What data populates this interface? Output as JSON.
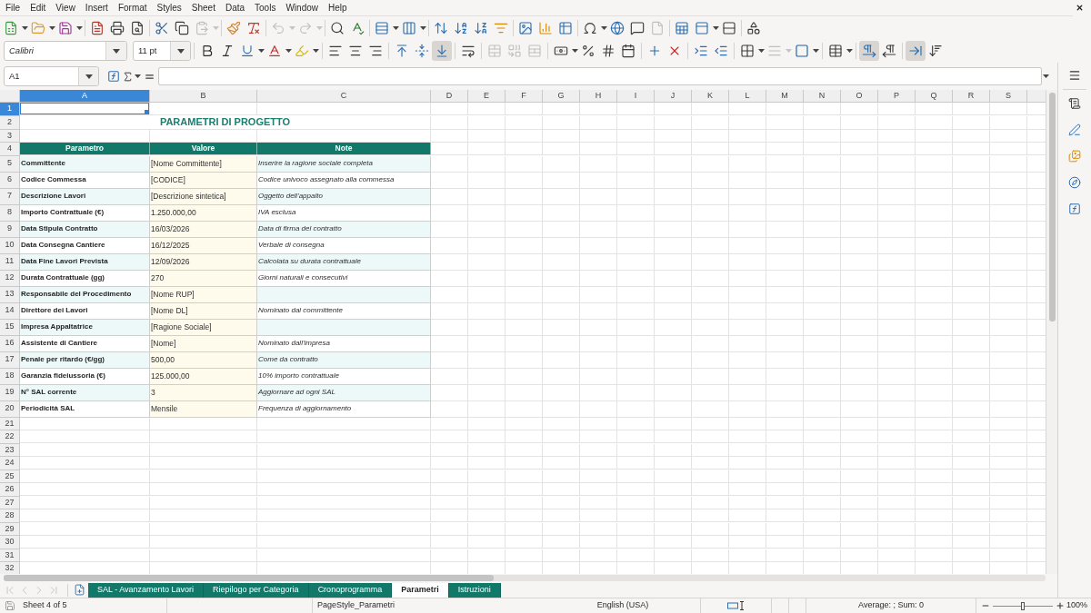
{
  "menu": [
    "File",
    "Edit",
    "View",
    "Insert",
    "Format",
    "Styles",
    "Sheet",
    "Data",
    "Tools",
    "Window",
    "Help"
  ],
  "standard_toolbar": [
    [
      {
        "kind": "new",
        "disabled": false
      },
      {
        "kind": "open",
        "disabled": false
      },
      {
        "kind": "save",
        "disabled": false
      }
    ],
    [
      {
        "kind": "pdf",
        "disabled": false
      },
      {
        "kind": "print",
        "disabled": false
      },
      {
        "kind": "preview",
        "disabled": false
      }
    ],
    [
      {
        "kind": "cut",
        "disabled": false
      },
      {
        "kind": "copy",
        "disabled": false
      },
      {
        "kind": "paste",
        "disabled": true
      }
    ],
    [
      {
        "kind": "clone",
        "disabled": false
      },
      {
        "kind": "clear",
        "disabled": false
      }
    ],
    [
      {
        "kind": "undo",
        "disabled": true
      },
      {
        "kind": "redo",
        "disabled": true
      }
    ],
    [
      {
        "kind": "find",
        "disabled": false
      },
      {
        "kind": "spelling",
        "disabled": false
      }
    ],
    [
      {
        "kind": "row",
        "disabled": false
      },
      {
        "kind": "column",
        "disabled": false
      }
    ],
    [
      {
        "kind": "sort",
        "disabled": false
      },
      {
        "kind": "ascending",
        "disabled": false
      },
      {
        "kind": "descending",
        "disabled": false
      },
      {
        "kind": "filter",
        "disabled": false
      }
    ],
    [
      {
        "kind": "image",
        "disabled": false
      },
      {
        "kind": "chart",
        "disabled": false
      },
      {
        "kind": "pivot",
        "disabled": false
      }
    ],
    [
      {
        "kind": "symbol",
        "disabled": false
      },
      {
        "kind": "hyperlink",
        "disabled": false
      },
      {
        "kind": "comment",
        "disabled": false
      },
      {
        "kind": "headers",
        "disabled": true
      }
    ],
    [
      {
        "kind": "printarea",
        "disabled": false
      },
      {
        "kind": "freeze",
        "disabled": false
      },
      {
        "kind": "split",
        "disabled": false
      }
    ],
    [
      {
        "kind": "draw",
        "disabled": false
      }
    ]
  ],
  "format_toolbar": {
    "font_name": "Calibri",
    "font_size": "11 pt",
    "groups": [
      [
        {
          "kind": "bold",
          "on": false,
          "disabled": false
        },
        {
          "kind": "italic",
          "on": false,
          "disabled": false
        },
        {
          "kind": "underline",
          "on": false,
          "disabled": false
        },
        {
          "kind": "fontcolor",
          "on": false,
          "disabled": false
        },
        {
          "kind": "highlight",
          "on": false,
          "disabled": false
        }
      ],
      [
        {
          "kind": "left",
          "on": false,
          "disabled": false
        },
        {
          "kind": "center",
          "on": false,
          "disabled": false
        },
        {
          "kind": "right",
          "on": false,
          "disabled": false
        }
      ],
      [
        {
          "kind": "top",
          "on": false,
          "disabled": false
        },
        {
          "kind": "middle",
          "on": false,
          "disabled": false
        },
        {
          "kind": "bottom",
          "on": true,
          "disabled": false
        }
      ],
      [
        {
          "kind": "wrap",
          "on": false,
          "disabled": false
        }
      ],
      [
        {
          "kind": "mergecenter",
          "on": false,
          "disabled": true
        },
        {
          "kind": "merge",
          "on": false,
          "disabled": true
        },
        {
          "kind": "unmerge",
          "on": false,
          "disabled": true
        }
      ],
      [
        {
          "kind": "currency",
          "on": false,
          "disabled": false
        },
        {
          "kind": "percent",
          "on": false,
          "disabled": false
        },
        {
          "kind": "number",
          "on": false,
          "disabled": false
        },
        {
          "kind": "date",
          "on": false,
          "disabled": false
        }
      ],
      [
        {
          "kind": "adddecimal",
          "on": false,
          "disabled": false
        },
        {
          "kind": "deldecimal",
          "on": false,
          "disabled": false
        }
      ],
      [
        {
          "kind": "indent",
          "on": false,
          "disabled": false
        },
        {
          "kind": "outdent",
          "on": false,
          "disabled": false
        }
      ],
      [
        {
          "kind": "borders",
          "on": false,
          "disabled": false
        },
        {
          "kind": "borderstyle",
          "on": false,
          "disabled": true
        },
        {
          "kind": "bordercolor",
          "on": false,
          "disabled": false
        }
      ],
      [
        {
          "kind": "conditional",
          "on": false,
          "disabled": false
        }
      ],
      [
        {
          "kind": "ltr",
          "on": true,
          "disabled": false
        },
        {
          "kind": "rtl",
          "on": false,
          "disabled": false
        }
      ],
      [
        {
          "kind": "horizontal",
          "on": true,
          "disabled": false
        },
        {
          "kind": "vertical",
          "on": false,
          "disabled": false
        }
      ]
    ]
  },
  "formula_bar": {
    "cell_reference": "A1"
  },
  "sheet": {
    "columns": [
      {
        "label": "A",
        "selected": true
      },
      {
        "label": "B",
        "selected": false
      },
      {
        "label": "C",
        "selected": false
      },
      {
        "label": "D",
        "selected": false
      },
      {
        "label": "E",
        "selected": false
      },
      {
        "label": "F",
        "selected": false
      },
      {
        "label": "G",
        "selected": false
      },
      {
        "label": "H",
        "selected": false
      },
      {
        "label": "I",
        "selected": false
      },
      {
        "label": "J",
        "selected": false
      },
      {
        "label": "K",
        "selected": false
      },
      {
        "label": "L",
        "selected": false
      },
      {
        "label": "M",
        "selected": false
      },
      {
        "label": "N",
        "selected": false
      },
      {
        "label": "O",
        "selected": false
      },
      {
        "label": "P",
        "selected": false
      },
      {
        "label": "Q",
        "selected": false
      },
      {
        "label": "R",
        "selected": false
      },
      {
        "label": "S",
        "selected": false
      }
    ],
    "rows": [
      {
        "number": "1",
        "selected": true,
        "kind": "blank"
      },
      {
        "number": "2",
        "selected": false,
        "kind": "title",
        "cells": [
          "PARAMETRI DI PROGETTO"
        ]
      },
      {
        "number": "3",
        "selected": false,
        "kind": "blank"
      },
      {
        "number": "4",
        "selected": false,
        "kind": "header",
        "cells": [
          "Parametro",
          "Valore",
          "Note"
        ]
      },
      {
        "number": "5",
        "selected": false,
        "kind": "data",
        "cells": [
          "Committente",
          "[Nome Committente]",
          "Inserire la ragione sociale completa"
        ]
      },
      {
        "number": "6",
        "selected": false,
        "kind": "data",
        "cells": [
          "Codice Commessa",
          "[CODICE]",
          "Codice univoco assegnato alla commessa"
        ]
      },
      {
        "number": "7",
        "selected": false,
        "kind": "data",
        "cells": [
          "Descrizione Lavori",
          "[Descrizione sintetica]",
          "Oggetto dell'appalto"
        ]
      },
      {
        "number": "8",
        "selected": false,
        "kind": "data",
        "cells": [
          "Importo Contrattuale (€)",
          "1.250.000,00",
          "IVA esclusa"
        ]
      },
      {
        "number": "9",
        "selected": false,
        "kind": "data",
        "cells": [
          "Data Stipula Contratto",
          "16/03/2026",
          "Data di firma del contratto"
        ]
      },
      {
        "number": "10",
        "selected": false,
        "kind": "data",
        "cells": [
          "Data Consegna Cantiere",
          "16/12/2025",
          "Verbale di consegna"
        ]
      },
      {
        "number": "11",
        "selected": false,
        "kind": "data",
        "cells": [
          "Data Fine Lavori Prevista",
          "12/09/2026",
          "Calcolata su durata contrattuale"
        ]
      },
      {
        "number": "12",
        "selected": false,
        "kind": "data",
        "cells": [
          "Durata Contrattuale (gg)",
          "270",
          "Giorni naturali e consecutivi"
        ]
      },
      {
        "number": "13",
        "selected": false,
        "kind": "data",
        "cells": [
          "Responsabile del Procedimento",
          "[Nome RUP]"
        ]
      },
      {
        "number": "14",
        "selected": false,
        "kind": "data",
        "cells": [
          "Direttore dei Lavori",
          "[Nome DL]",
          "Nominato dal committente"
        ]
      },
      {
        "number": "15",
        "selected": false,
        "kind": "data",
        "cells": [
          "Impresa Appaltatrice",
          "[Ragione Sociale]"
        ]
      },
      {
        "number": "16",
        "selected": false,
        "kind": "data",
        "cells": [
          "Assistente di Cantiere",
          "[Nome]",
          "Nominato dall'impresa"
        ]
      },
      {
        "number": "17",
        "selected": false,
        "kind": "data",
        "cells": [
          "Penale per ritardo (€/gg)",
          "500,00",
          "Come da contratto"
        ]
      },
      {
        "number": "18",
        "selected": false,
        "kind": "data",
        "cells": [
          "Garanzia fideiussoria (€)",
          "125.000,00",
          "10% importo contrattuale"
        ]
      },
      {
        "number": "19",
        "selected": false,
        "kind": "data",
        "cells": [
          "N° SAL corrente",
          "3",
          "Aggiornare ad ogni SAL"
        ]
      },
      {
        "number": "20",
        "selected": false,
        "kind": "data",
        "cells": [
          "Periodicità SAL",
          "Mensile",
          "Frequenza di aggiornamento"
        ]
      },
      {
        "number": "21",
        "selected": false,
        "kind": "blank"
      },
      {
        "number": "22",
        "selected": false,
        "kind": "blank"
      },
      {
        "number": "23",
        "selected": false,
        "kind": "blank"
      },
      {
        "number": "24",
        "selected": false,
        "kind": "blank"
      },
      {
        "number": "25",
        "selected": false,
        "kind": "blank"
      },
      {
        "number": "26",
        "selected": false,
        "kind": "blank"
      },
      {
        "number": "27",
        "selected": false,
        "kind": "blank"
      },
      {
        "number": "28",
        "selected": false,
        "kind": "blank"
      },
      {
        "number": "29",
        "selected": false,
        "kind": "blank"
      },
      {
        "number": "30",
        "selected": false,
        "kind": "blank"
      },
      {
        "number": "31",
        "selected": false,
        "kind": "blank"
      },
      {
        "number": "32",
        "selected": false,
        "kind": "blank"
      }
    ]
  },
  "sheet_nav": [
    {
      "kind": "first",
      "disabled": true
    },
    {
      "kind": "previous",
      "disabled": true
    },
    {
      "kind": "next",
      "disabled": true
    },
    {
      "kind": "last",
      "disabled": true
    }
  ],
  "sheet_tabs": [
    {
      "label": "SAL - Avanzamento Lavori",
      "selected": false
    },
    {
      "label": "Riepilogo per Categoria",
      "selected": false
    },
    {
      "label": "Cronoprogramma",
      "selected": false
    },
    {
      "label": "Parametri",
      "selected": true
    },
    {
      "label": "Istruzioni",
      "selected": false
    }
  ],
  "status_bar": {
    "sheet": "Sheet 4 of 5",
    "page_style": "PageStyle_Parametri",
    "language": "English (USA)",
    "summary": "Average: ; Sum: 0",
    "zoom": {
      "level": 0.5,
      "reading": "100%"
    }
  }
}
